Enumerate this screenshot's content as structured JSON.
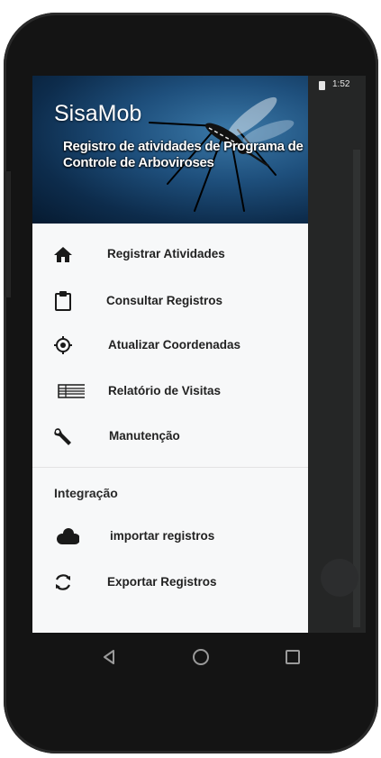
{
  "status_bar": {
    "time": "1:52"
  },
  "header": {
    "app_name": "SisaMob",
    "subtitle": "Registro de atividades de Programa de Controle de Arboviroses"
  },
  "menu": {
    "items": [
      {
        "label": "Registrar Atividades",
        "icon": "home-icon"
      },
      {
        "label": "Consultar Registros",
        "icon": "clipboard-icon"
      },
      {
        "label": "Atualizar Coordenadas",
        "icon": "gps-fixed-icon"
      },
      {
        "label": "Relatório de Visitas",
        "icon": "list-icon"
      },
      {
        "label": "Manutenção",
        "icon": "wrench-icon"
      }
    ],
    "section_title": "Integração",
    "integration_items": [
      {
        "label": "importar registros",
        "icon": "cloud-icon"
      },
      {
        "label": "Exportar Registros",
        "icon": "sync-icon"
      }
    ]
  },
  "navigation_bar": {
    "buttons": [
      "back",
      "home",
      "recents"
    ]
  },
  "colors": {
    "drawer_bg": "#f7f8f9",
    "header_bg": "#1e4f7c",
    "text": "#222222",
    "phone_body": "#141414"
  }
}
